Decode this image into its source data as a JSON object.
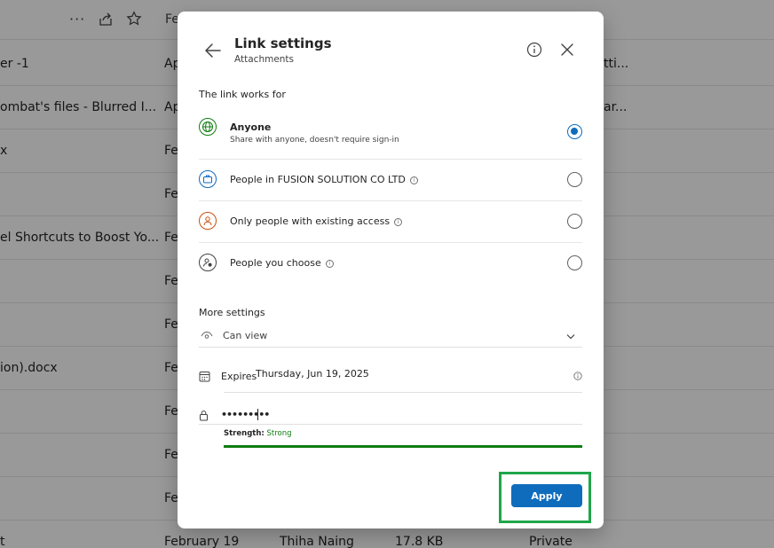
{
  "background": {
    "toolbar": {
      "partial_text": "Fe"
    },
    "rows": [
      {
        "name": "er -1",
        "col2": "Ap",
        "col5": "tti..."
      },
      {
        "name": "ombat's files - Blurred I...",
        "col2": "Ap",
        "col5": "ar..."
      },
      {
        "name": "x",
        "col2": "Fe",
        "col5": ""
      },
      {
        "name": "",
        "col2": "Fe",
        "col5": ""
      },
      {
        "name": "el Shortcuts to Boost Yo...",
        "col2": "Fe",
        "col5": ""
      },
      {
        "name": "",
        "col2": "Fe",
        "col5": ""
      },
      {
        "name": "",
        "col2": "Fe",
        "col5": ""
      },
      {
        "name": "ion).docx",
        "col2": "Fe",
        "col5": ""
      },
      {
        "name": "",
        "col2": "Fe",
        "col5": ""
      },
      {
        "name": "",
        "col2": "Fe",
        "col5": ""
      },
      {
        "name": "",
        "col2": "Fe",
        "col5": ""
      }
    ],
    "last_row": {
      "name": "t",
      "modified": "February 19",
      "owner": "Thiha Naing",
      "size": "17.8 KB",
      "sharing": "Private"
    }
  },
  "dialog": {
    "title": "Link settings",
    "subtitle": "Attachments",
    "link_works_for_label": "The link works for",
    "options": [
      {
        "label": "Anyone",
        "description": "Share with anyone, doesn't require sign-in",
        "selected": true,
        "icon": "globe-icon",
        "color": "#107c10"
      },
      {
        "label": "People in FUSION SOLUTION CO LTD",
        "selected": false,
        "icon": "briefcase-icon",
        "color": "#0f6cbd"
      },
      {
        "label": "Only people with existing access",
        "selected": false,
        "icon": "person-icon",
        "color": "#ca5010"
      },
      {
        "label": "People you choose",
        "selected": false,
        "icon": "person-settings-icon",
        "color": "#424242"
      }
    ],
    "more_settings_label": "More settings",
    "permission": {
      "value": "Can view"
    },
    "expires": {
      "label": "Expires",
      "value": "Thursday, Jun 19, 2025"
    },
    "password": {
      "value": "•••••••••"
    },
    "strength": {
      "label": "Strength:",
      "value": "Strong",
      "color": "#107c10"
    },
    "apply_label": "Apply"
  }
}
